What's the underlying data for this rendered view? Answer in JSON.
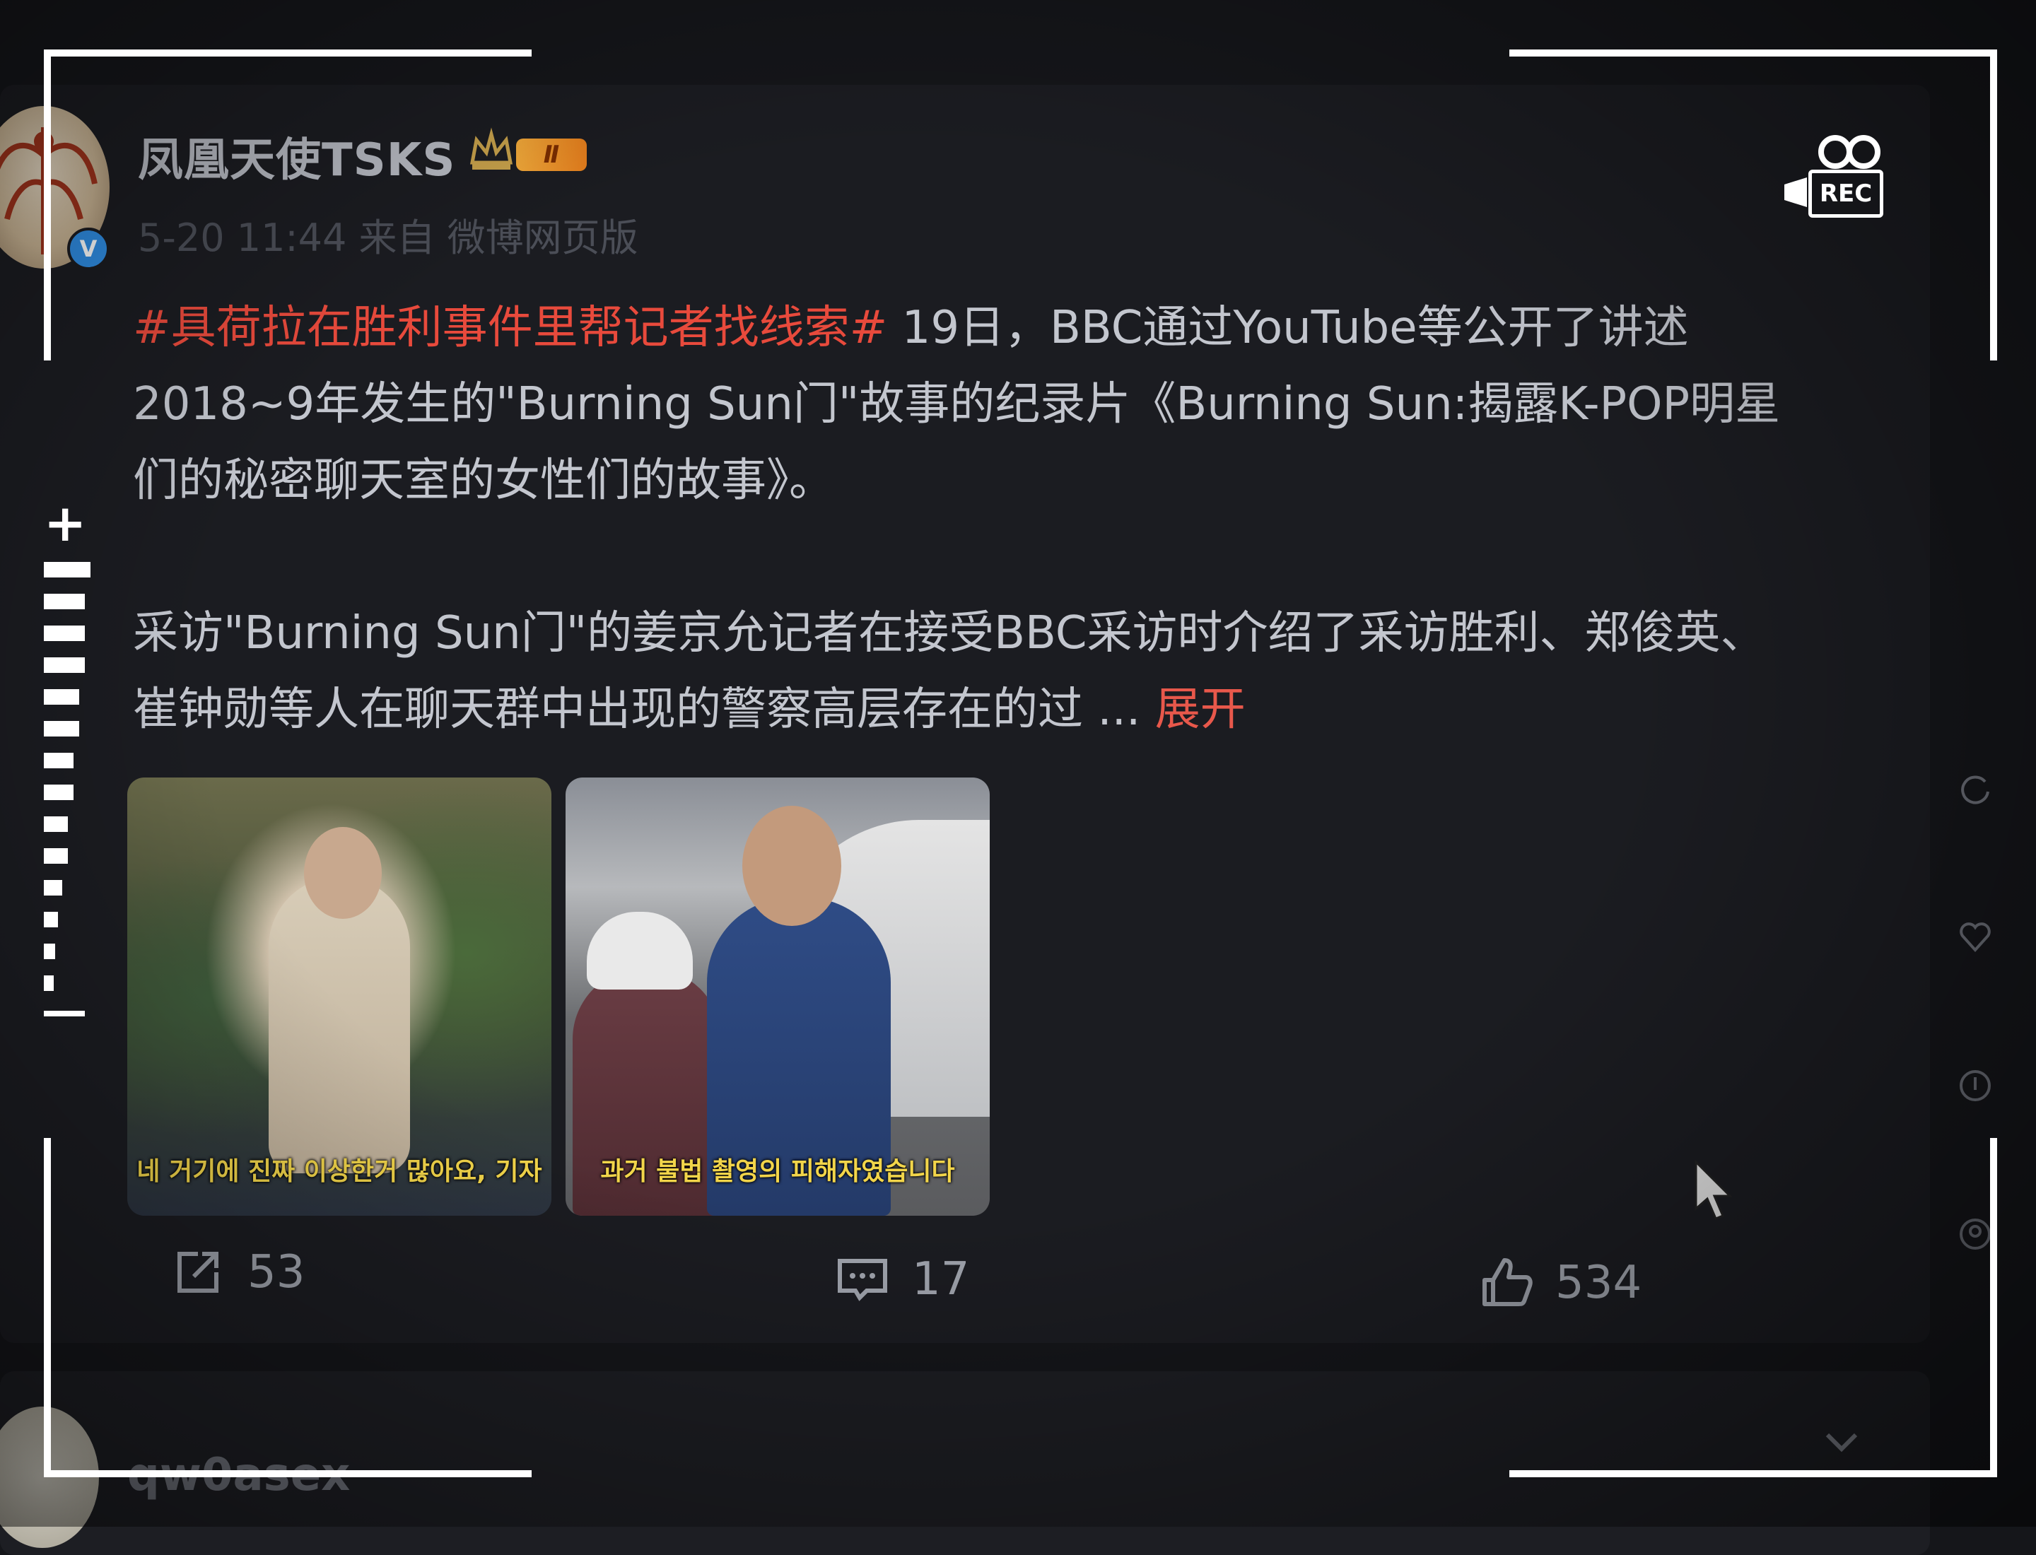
{
  "post": {
    "username": "凤凰天使TSKS",
    "level_badge": "Ⅱ",
    "verified_mark": "V",
    "meta": "5-20 11:44  来自 微博网页版",
    "hashtag": "#具荷拉在胜利事件里帮记者找线索#",
    "body_line1": " 19日，BBC通过YouTube等公开了讲述",
    "body_line2": "2018~9年发生的\"Burning Sun门\"故事的纪录片《Burning Sun:揭露K-POP明星",
    "body_line3": "们的秘密聊天室的女性们的故事》。",
    "body_para2_line1": "采访\"Burning Sun门\"的姜京允记者在接受BBC采访时介绍了采访胜利、郑俊英、",
    "body_para2_line2": "崔钟勋等人在聊天群中出现的警察高层存在的过 ... ",
    "expand_label": "展开",
    "images": [
      {
        "caption": "네 거기에 진짜 이상한거 많아요, 기자"
      },
      {
        "caption": "과거 불법 촬영의 피해자였습니다"
      }
    ],
    "actions": {
      "share_count": "53",
      "comment_count": "17",
      "like_count": "534"
    }
  },
  "next_post": {
    "username": "qw0asex"
  },
  "overlay": {
    "rec_label": "REC",
    "zoom_plus": "+"
  },
  "colors": {
    "hashtag": "#e84a3c",
    "expand": "#e8584b",
    "verified": "#2f8de4"
  },
  "icons": [
    "share-icon",
    "comment-icon",
    "like-icon",
    "chevron-down-icon",
    "camera-icon",
    "cursor-icon"
  ]
}
